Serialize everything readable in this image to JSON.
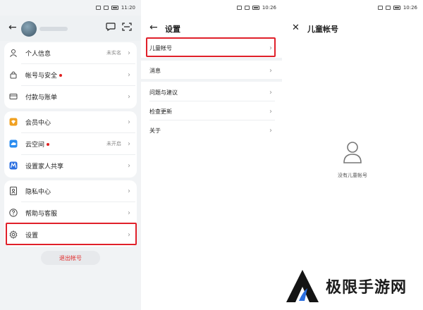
{
  "status": {
    "p1_time": "11:20",
    "p2_time": "10:26",
    "p3_time": "10:26"
  },
  "account": {
    "rows": [
      {
        "label": "个人信息",
        "value": "未实名",
        "icon": "person-icon",
        "dot": false
      },
      {
        "label": "帐号与安全",
        "value": "",
        "icon": "lock-icon",
        "dot": true
      },
      {
        "label": "付款与账单",
        "value": "",
        "icon": "card-icon",
        "dot": false
      },
      {
        "label": "会员中心",
        "value": "",
        "icon": "member-icon",
        "dot": false
      },
      {
        "label": "云空间",
        "value": "未开启",
        "icon": "cloud-icon",
        "dot": true
      },
      {
        "label": "设置家人共享",
        "value": "",
        "icon": "family-share-icon",
        "dot": false
      },
      {
        "label": "隐私中心",
        "value": "",
        "icon": "privacy-icon",
        "dot": false
      },
      {
        "label": "帮助与客服",
        "value": "",
        "icon": "help-icon",
        "dot": false
      },
      {
        "label": "设置",
        "value": "",
        "icon": "gear-icon",
        "dot": false
      }
    ],
    "logout_label": "退出帐号"
  },
  "settings": {
    "title": "设置",
    "rows": [
      {
        "label": "儿童帐号"
      },
      {
        "label": "消息"
      },
      {
        "label": "问题与建议"
      },
      {
        "label": "检查更新"
      },
      {
        "label": "关于"
      }
    ]
  },
  "child": {
    "title": "儿童帐号",
    "empty_text": "没有儿童帐号"
  },
  "watermark": {
    "text": "极限手游网"
  },
  "colors": {
    "highlight": "#e0202a",
    "badge": "#e02020",
    "member": "#f0a020",
    "cloud": "#2a8cf0",
    "family": "#2a6ee0"
  }
}
